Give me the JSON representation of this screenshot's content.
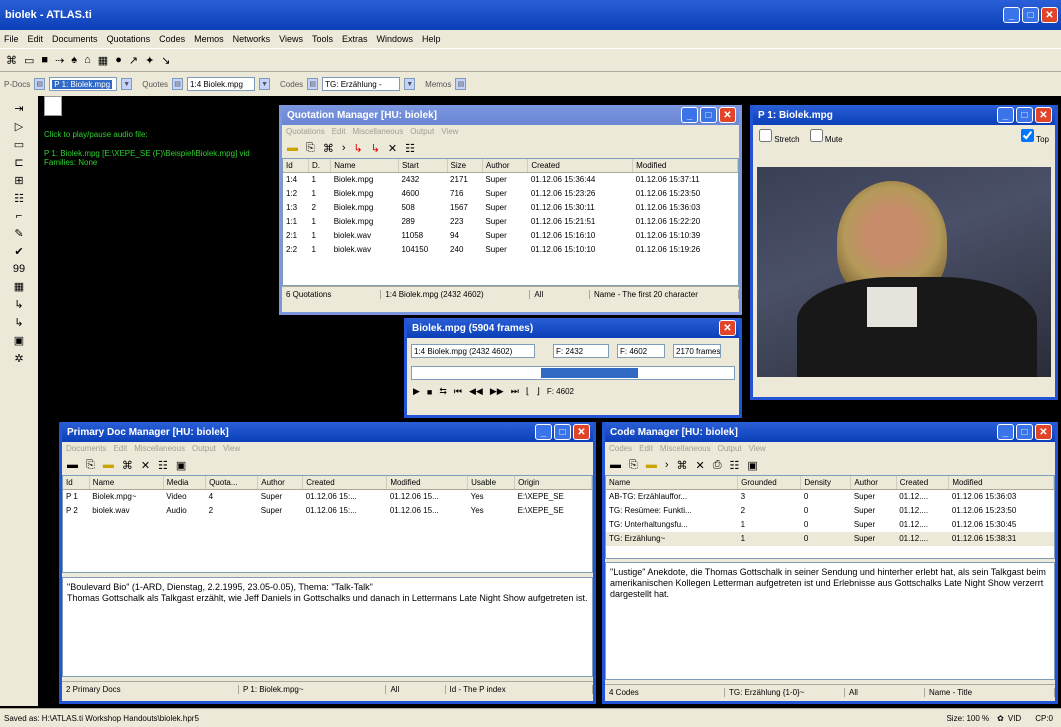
{
  "app": {
    "title": "biolek - ATLAS.ti"
  },
  "menu": [
    "File",
    "Edit",
    "Documents",
    "Quotations",
    "Codes",
    "Memos",
    "Networks",
    "Views",
    "Tools",
    "Extras",
    "Windows",
    "Help"
  ],
  "combos": {
    "pdocs_label": "P-Docs",
    "pdocs_value": "P 1: Biolek.mpg",
    "quotes_label": "Quotes",
    "quotes_value": "1:4 Biolek.mpg",
    "codes_label": "Codes",
    "codes_value": "TG: Erzählung -",
    "memos_label": "Memos"
  },
  "doc": {
    "line1": "Click to play/pause audio file:",
    "line2": "P 1: Biolek.mpg [E:\\XEPE_SE (F)\\Beispiel\\Biolek.mpg] vid",
    "line3": "Families: None"
  },
  "qm": {
    "title": "Quotation Manager [HU: biolek]",
    "menus": [
      "Quotations",
      "Edit",
      "Miscellaneous",
      "Output",
      "View"
    ],
    "columns": [
      "Id",
      "D.",
      "Name",
      "Start",
      "Size",
      "Author",
      "Created",
      "Modified"
    ],
    "rows": [
      [
        "1:4",
        "1",
        "Biolek.mpg",
        "2432",
        "2171",
        "Super",
        "01.12.06 15:36:44",
        "01.12.06 15:37:11"
      ],
      [
        "1:2",
        "1",
        "Biolek.mpg",
        "4600",
        "716",
        "Super",
        "01.12.06 15:23:26",
        "01.12.06 15:23:50"
      ],
      [
        "1:3",
        "2",
        "Biolek.mpg",
        "508",
        "1567",
        "Super",
        "01.12.06 15:30:11",
        "01.12.06 15:36:03"
      ],
      [
        "1:1",
        "1",
        "Biolek.mpg",
        "289",
        "223",
        "Super",
        "01.12.06 15:21:51",
        "01.12.06 15:22:20"
      ],
      [
        "2:1",
        "1",
        "biolek.wav",
        "11058",
        "94",
        "Super",
        "01.12.06 15:16:10",
        "01.12.06 15:10:39"
      ],
      [
        "2:2",
        "1",
        "biolek.wav",
        "104150",
        "240",
        "Super",
        "01.12.06 15:10:10",
        "01.12.06 15:19:26"
      ]
    ],
    "status": [
      "6 Quotations",
      "1:4 Biolek.mpg (2432 4602)",
      "All",
      "Name - The first 20 character"
    ]
  },
  "video": {
    "title": "P 1: Biolek.mpg",
    "stretch": "Stretch",
    "mute": "Mute",
    "top": "Top"
  },
  "media": {
    "title": "Biolek.mpg (5904 frames)",
    "quote": "1:4 Biolek.mpg (2432 4602)",
    "f1": "F: 2432",
    "f2": "F: 4602",
    "frames": "2170 frames",
    "pos": "F: 4602",
    "progress": 0.43
  },
  "pdm": {
    "title": "Primary Doc Manager [HU: biolek]",
    "menus": [
      "Documents",
      "Edit",
      "Miscellaneous",
      "Output",
      "View"
    ],
    "columns": [
      "Id",
      "Name",
      "Media",
      "Quota...",
      "Author",
      "Created",
      "Modified",
      "Usable",
      "Origin"
    ],
    "rows": [
      [
        "P 1",
        "Biolek.mpg~",
        "Video",
        "4",
        "Super",
        "01.12.06 15:...",
        "01.12.06 15...",
        "Yes",
        "E:\\XEPE_SE"
      ],
      [
        "P 2",
        "biolek.wav",
        "Audio",
        "2",
        "Super",
        "01.12.06 15:...",
        "01.12.06 15...",
        "Yes",
        "E:\\XEPE_SE"
      ]
    ],
    "comment": "\"Boulevard Bio\" (1-ARD, Dienstag, 2.2.1995, 23.05-0.05), Thema: \"Talk-Talk\"\nThomas Gottschalk als Talkgast erzählt, wie Jeff Daniels in Gottschalks und danach in Lettermans Late Night Show aufgetreten ist.",
    "status": [
      "2 Primary Docs",
      "P 1: Biolek.mpg~",
      "All",
      "Id - The P index"
    ]
  },
  "cm": {
    "title": "Code Manager [HU: biolek]",
    "menus": [
      "Codes",
      "Edit",
      "Miscellaneous",
      "Output",
      "View"
    ],
    "columns": [
      "Name",
      "Grounded",
      "Density",
      "Author",
      "Created",
      "Modified"
    ],
    "rows": [
      [
        "AB-TG: Erzählauffor...",
        "3",
        "0",
        "Super",
        "01.12....",
        "01.12.06 15:36:03"
      ],
      [
        "TG: Resümee: Funkti...",
        "2",
        "0",
        "Super",
        "01.12....",
        "01.12.06 15:23:50"
      ],
      [
        "TG: Unterhaltungsfu...",
        "1",
        "0",
        "Super",
        "01.12....",
        "01.12.06 15:30:45"
      ],
      [
        "TG: Erzählung~",
        "1",
        "0",
        "Super",
        "01.12....",
        "01.12.06 15:38:31"
      ]
    ],
    "comment": "\"Lustige\" Anekdote, die Thomas Gottschalk in seiner Sendung und hinterher erlebt hat, als sein Talkgast beim amerikanischen Kollegen Letterman aufgetreten ist und Erlebnisse aus Gottschalks Late Night Show verzerrt dargestellt hat.",
    "status": [
      "4 Codes",
      "TG: Erzählung {1-0}~",
      "All",
      "Name - Title"
    ]
  },
  "statusbar": {
    "saved": "Saved as: H:\\ATLAS.ti Workshop Handouts\\biolek.hpr5",
    "size": "Size: 100 %",
    "vid": "VID",
    "cp": "CP:0"
  }
}
